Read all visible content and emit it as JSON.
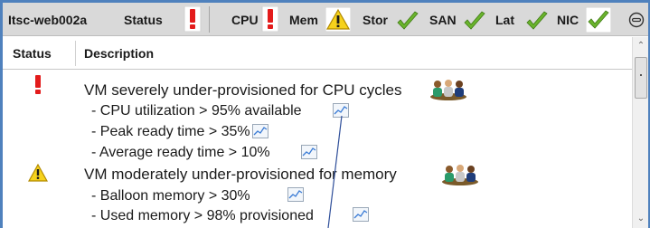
{
  "header": {
    "vm_name": "Itsc-web002a",
    "status_label": "Status",
    "metrics": [
      {
        "label": "CPU",
        "state": "critical"
      },
      {
        "label": "Mem",
        "state": "warning"
      },
      {
        "label": "Stor",
        "state": "ok"
      },
      {
        "label": "SAN",
        "state": "ok"
      },
      {
        "label": "Lat",
        "state": "ok"
      },
      {
        "label": "NIC",
        "state": "ok"
      }
    ],
    "collapse_icon": "collapse-circle-icon"
  },
  "table": {
    "columns": [
      "Status",
      "Description"
    ]
  },
  "findings": [
    {
      "severity": "critical",
      "title": "VM severely under-provisioned for CPU cycles",
      "details": [
        "- CPU utilization > 95% available",
        "- Peak ready time > 35%",
        "- Average ready time > 10%"
      ]
    },
    {
      "severity": "warning",
      "title": "VM moderately under-provisioned for memory",
      "details": [
        "- Balloon memory > 30%",
        "- Used memory > 98% provisioned"
      ]
    }
  ],
  "colors": {
    "critical": "#e31b1b",
    "warning": "#f6d21c",
    "ok": "#6ab42d",
    "accent": "#4f81bd"
  }
}
